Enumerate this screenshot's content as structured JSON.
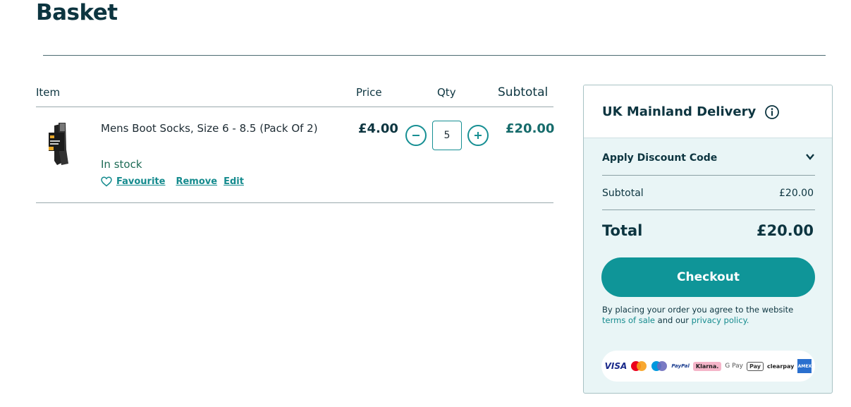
{
  "page": {
    "title": "Basket"
  },
  "columns": {
    "item": "Item",
    "price": "Price",
    "qty": "Qty",
    "subtotal": "Subtotal"
  },
  "line_item": {
    "name": "Mens Boot Socks, Size 6 - 8.5 (Pack Of 2)",
    "stock": "In stock",
    "favourite_label": "Favourite",
    "remove_label": "Remove",
    "edit_label": "Edit",
    "price": "£4.00",
    "quantity": "5",
    "subtotal": "£20.00"
  },
  "summary": {
    "delivery_title": "UK Mainland Delivery",
    "discount_label": "Apply Discount Code",
    "subtotal_label": "Subtotal",
    "subtotal_value": "£20.00",
    "total_label": "Total",
    "total_value": "£20.00",
    "checkout_label": "Checkout",
    "legal_prefix": "By placing your order you agree to the website",
    "terms_label": "terms of sale",
    "legal_and": "and our",
    "privacy_label": "privacy policy.",
    "payment_methods": {
      "visa": "VISA",
      "paypal": "PayPal",
      "klarna": "Klarna.",
      "gpay": "G Pay",
      "apay": "Pay",
      "clearpay": "clearpay",
      "amex": "AMEX"
    }
  },
  "colors": {
    "accent": "#0f9598",
    "heading": "#0d3540",
    "panel": "#e9f5f6",
    "in_stock": "#1d6b55"
  },
  "icons": {
    "heart": "heart-icon",
    "minus": "minus-icon",
    "plus": "plus-icon",
    "info": "info-icon",
    "chevron": "chevron-down-icon"
  }
}
